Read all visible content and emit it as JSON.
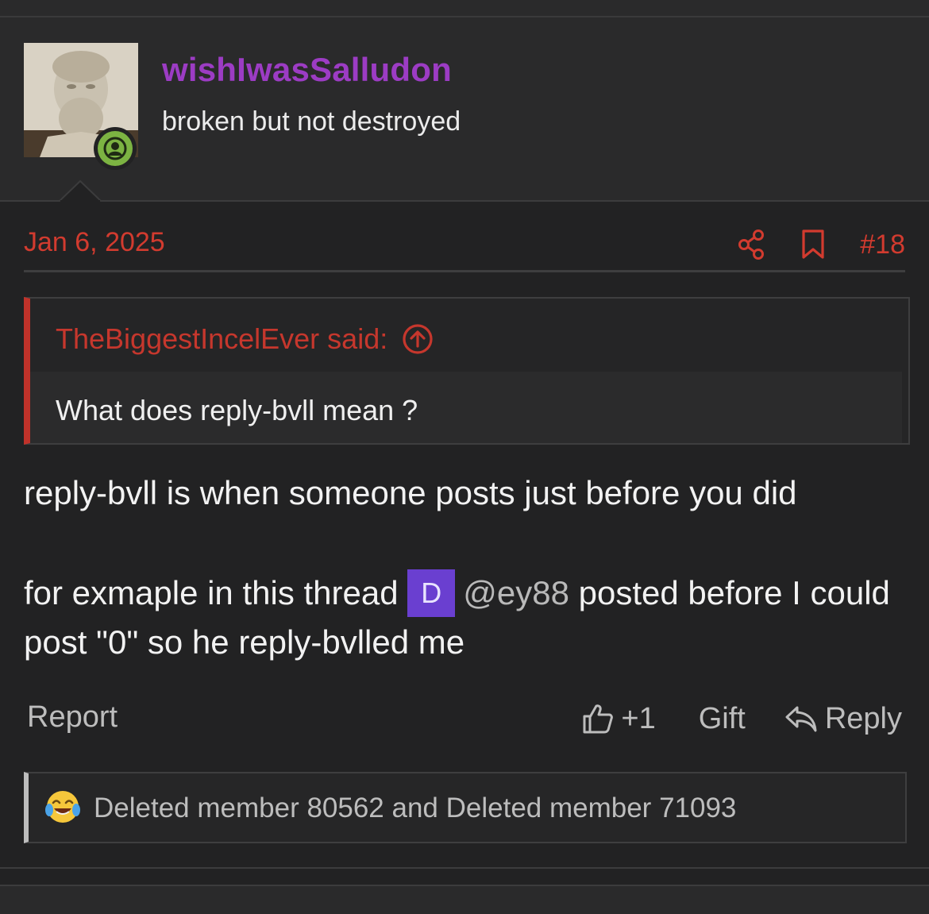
{
  "user": {
    "name": "wishIwasSalludon",
    "title": "broken but not destroyed",
    "avatar_icon": "bust-statue-avatar",
    "status_icon": "online-user-icon",
    "name_color": "#9c3cc4"
  },
  "post": {
    "date": "Jan 6, 2025",
    "number": "#18",
    "share_icon": "share-icon",
    "bookmark_icon": "bookmark-icon",
    "accent_color": "#d23b2f"
  },
  "quote": {
    "author": "TheBiggestIncelEver said:",
    "text": "What does reply-bvll mean ?",
    "jump_icon": "arrow-up-circle-icon"
  },
  "body": {
    "line1": "reply-bvll is when someone posts just before you did",
    "line2_before": "for exmaple in this thread ",
    "mention_avatar_letter": "D",
    "mention": "@ey88",
    "line2_after": " posted before I could post \"0\" so he reply-bvlled me"
  },
  "actions": {
    "report": "Report",
    "like_count": "+1",
    "gift": "Gift",
    "reply": "Reply"
  },
  "reactions": {
    "emoji": "tears-of-joy-emoji",
    "text": "Deleted member 80562 and Deleted member 71093"
  }
}
